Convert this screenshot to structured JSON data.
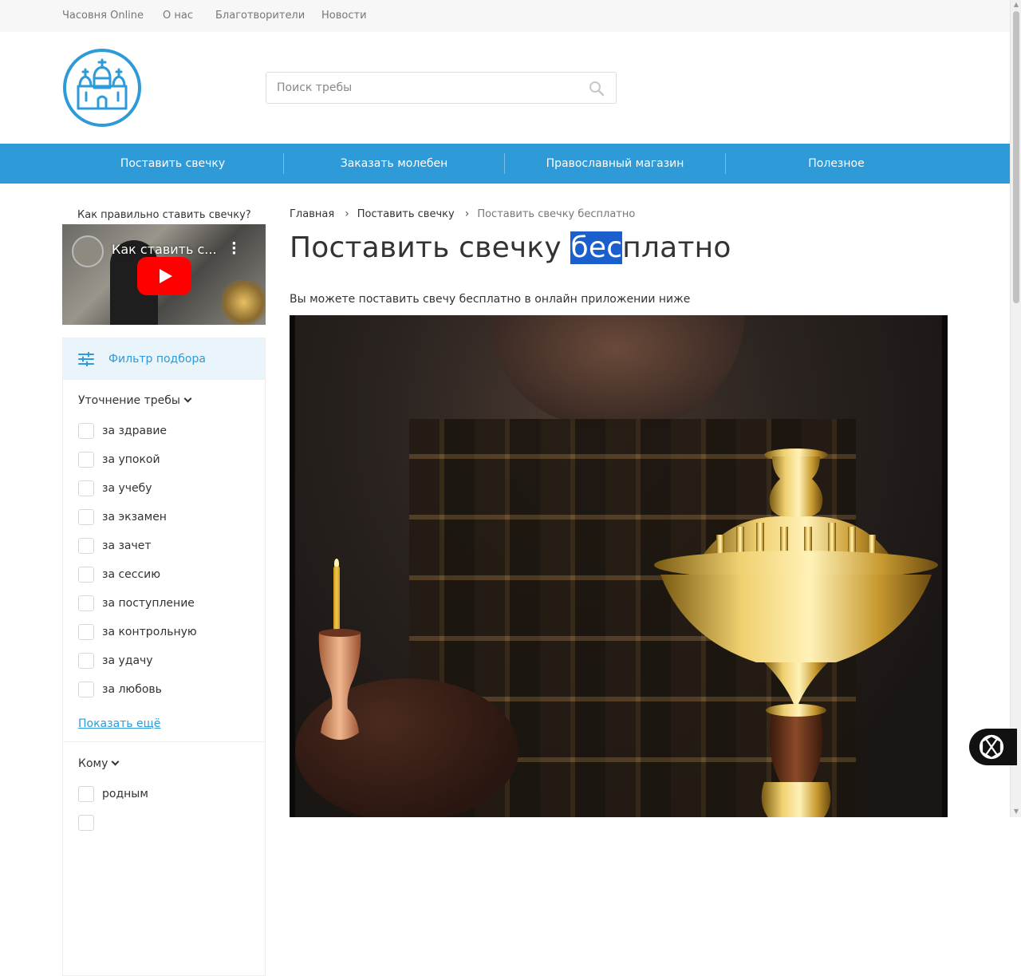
{
  "topbar": {
    "links": [
      "Часовня Online",
      "О нас",
      "Благотворители",
      "Новости"
    ]
  },
  "search": {
    "placeholder": "Поиск требы"
  },
  "nav": {
    "items": [
      "Поставить свечку",
      "Заказать молебен",
      "Православный магазин",
      "Полезное"
    ]
  },
  "sidebar": {
    "video_caption": "Как правильно ставить свечку?",
    "video_title": "Как ставить с...",
    "filter_title": "Фильтр подбора",
    "group1": {
      "title": "Уточнение требы",
      "options": [
        "за здравие",
        "за упокой",
        "за учебу",
        "за экзамен",
        "за зачет",
        "за сессию",
        "за поступление",
        "за контрольную",
        "за удачу",
        "за любовь"
      ]
    },
    "show_more": "Показать ещё",
    "group2": {
      "title": "Кому",
      "options": [
        "родным"
      ]
    }
  },
  "breadcrumb": {
    "items": [
      "Главная",
      "Поставить свечку",
      "Поставить свечку бесплатно"
    ]
  },
  "page": {
    "title_before": "Поставить свечку ",
    "title_highlight": "бес",
    "title_after": "платно",
    "intro": "Вы можете поставить свечу бесплатно в онлайн приложении ниже"
  },
  "colors": {
    "accent": "#2e9ad8",
    "selection": "#1b5fcc"
  },
  "icons": [
    "church-logo-icon",
    "search-icon",
    "filter-sliders-icon",
    "chevron-down-icon",
    "youtube-play-icon",
    "more-vert-icon",
    "chat-assistant-icon"
  ]
}
